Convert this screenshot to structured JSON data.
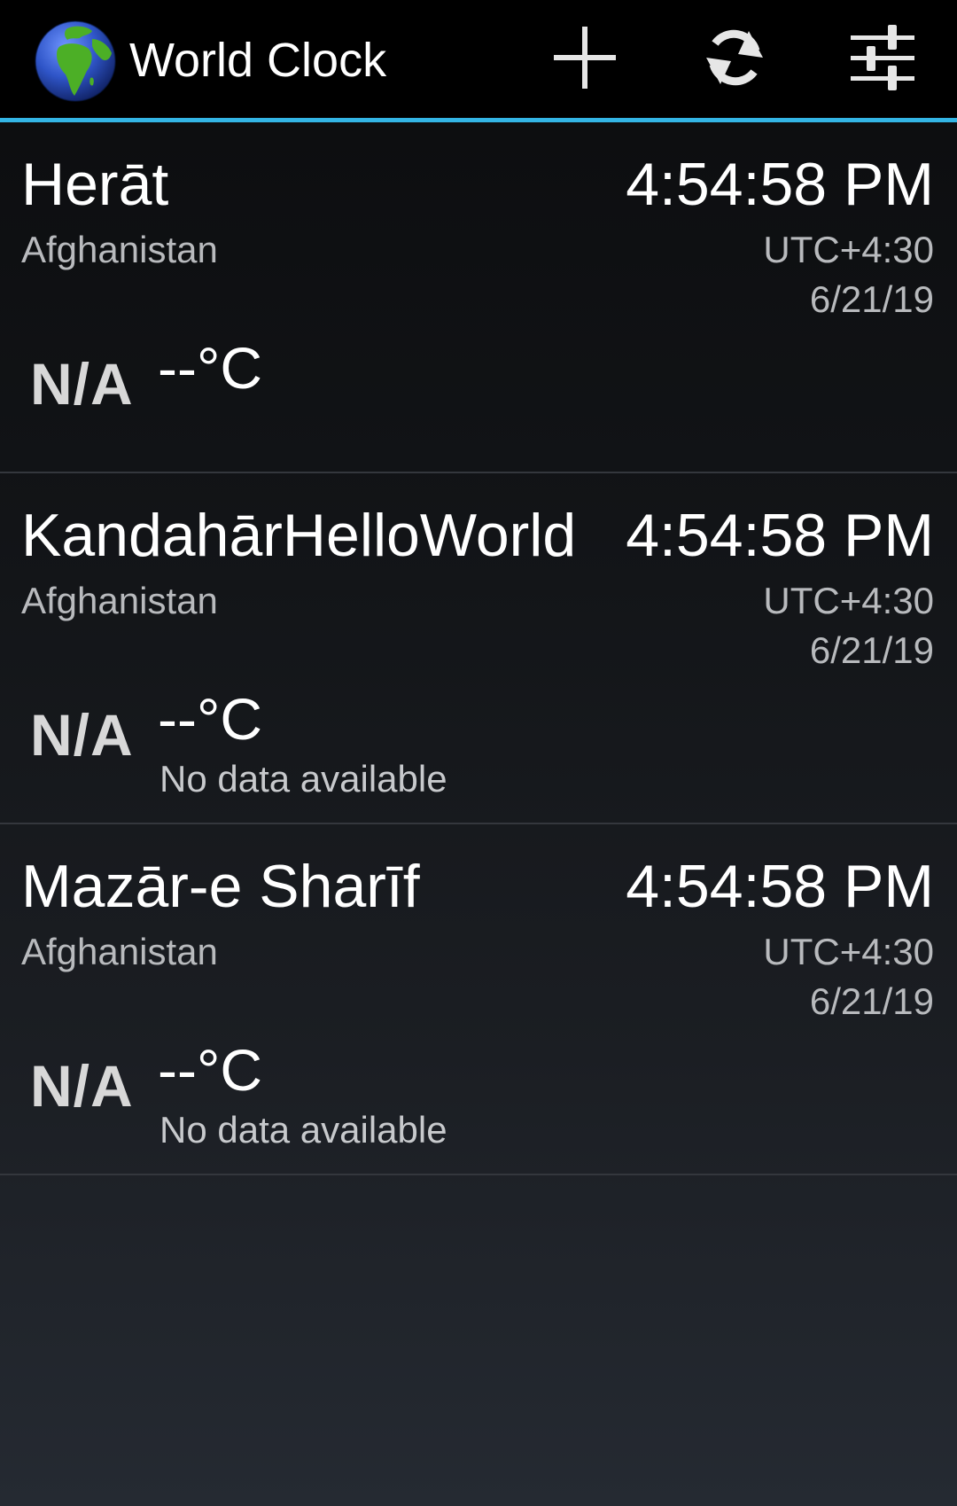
{
  "app": {
    "title": "World Clock",
    "icon": "globe-icon"
  },
  "actions": {
    "add": {
      "icon": "plus-icon"
    },
    "refresh": {
      "icon": "refresh-icon"
    },
    "settings": {
      "icon": "sliders-icon"
    }
  },
  "colors": {
    "accent": "#33b5e5",
    "action_bar": "#000000",
    "primary_text": "#ffffff",
    "secondary_text": "#b8babd",
    "divider": "#34373d",
    "globe_ocean": "#2f55c8",
    "globe_land": "#4caf26"
  },
  "clocks": [
    {
      "city": "Herāt",
      "country": "Afghanistan",
      "time": "4:54:58 PM",
      "utc_offset": "UTC+4:30",
      "date": "6/21/19",
      "weather_icon": "N/A",
      "temperature": "--°C",
      "description": ""
    },
    {
      "city": "KandahārHelloWorld",
      "country": "Afghanistan",
      "time": "4:54:58 PM",
      "utc_offset": "UTC+4:30",
      "date": "6/21/19",
      "weather_icon": "N/A",
      "temperature": "--°C",
      "description": "No data available"
    },
    {
      "city": "Mazār-e Sharīf",
      "country": "Afghanistan",
      "time": "4:54:58 PM",
      "utc_offset": "UTC+4:30",
      "date": "6/21/19",
      "weather_icon": "N/A",
      "temperature": "--°C",
      "description": "No data available"
    }
  ]
}
